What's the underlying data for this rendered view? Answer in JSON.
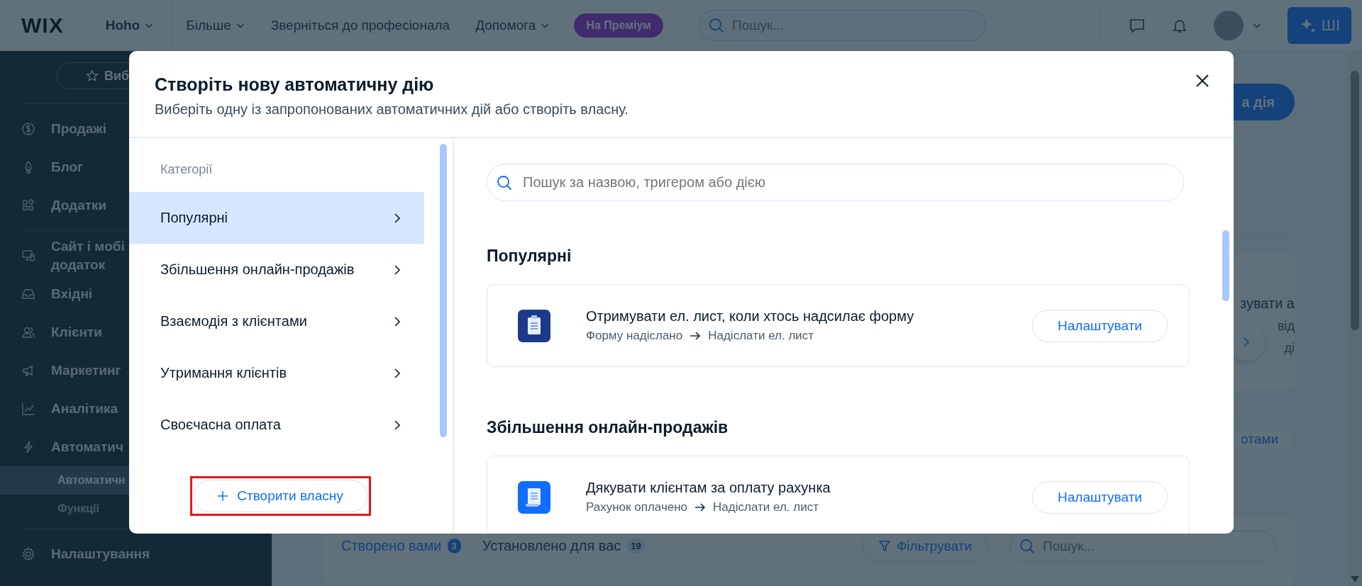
{
  "top_bar": {
    "logo": "WIX",
    "site_name": "Hoho",
    "menu": [
      {
        "label": "Більше",
        "caret": true
      },
      {
        "label": "Зверніться до професіонала",
        "caret": false
      },
      {
        "label": "Допомога",
        "caret": true
      }
    ],
    "upgrade_badge": "На Преміум",
    "search": {
      "placeholder": "Пошук..."
    },
    "ai_button": "ШІ"
  },
  "sidebar": {
    "favorites_button": "Виб",
    "groups": [
      {
        "items": [
          {
            "label": "Продажі"
          },
          {
            "label": "Блог"
          },
          {
            "label": "Додатки"
          }
        ]
      },
      {
        "items": [
          {
            "label": "Сайт і мобі\nдодаток"
          },
          {
            "label": "Вхідні"
          },
          {
            "label": "Клієнти"
          },
          {
            "label": "Маркетинг"
          },
          {
            "label": "Аналітика"
          },
          {
            "label": "Автоматич",
            "children": [
              {
                "label": "Автоматичн",
                "selected": true
              },
              {
                "label": "Функції",
                "selected": false
              }
            ]
          }
        ]
      },
      {
        "items": [
          {
            "label": "Налаштування"
          }
        ]
      }
    ]
  },
  "main": {
    "new_action_button": "а дія",
    "carousel_card": {
      "title": "зувати а",
      "lines": [
        "від",
        "ді"
      ]
    },
    "bots_button": "отами",
    "tabs": [
      {
        "label": "Створено вами",
        "count": "3",
        "selected": true
      },
      {
        "label": "Установлено для вас",
        "count": "19",
        "selected": false
      }
    ],
    "filter_button": "Фільтрувати",
    "search": {
      "placeholder": "Пошук..."
    }
  },
  "modal": {
    "title": "Створіть нову автоматичну дію",
    "subtitle": "Виберіть одну із запропонованих автоматичних дій або створіть власну.",
    "categories_label": "Категорії",
    "categories": [
      {
        "label": "Популярні",
        "selected": true
      },
      {
        "label": "Збільшення онлайн-продажів",
        "selected": false
      },
      {
        "label": "Взаємодія з клієнтами",
        "selected": false
      },
      {
        "label": "Утримання клієнтів",
        "selected": false
      },
      {
        "label": "Своєчасна оплата",
        "selected": false
      }
    ],
    "create_button": "Створити власну",
    "search": {
      "placeholder": "Пошук за назвою, тригером або дією"
    },
    "sections": [
      {
        "heading": "Популярні",
        "templates": [
          {
            "kind": "form",
            "title": "Отримувати ел. лист, коли хтось надсилає форму",
            "trigger": "Форму надіслано",
            "action": "Надіслати ел. лист",
            "button": "Налаштувати"
          }
        ]
      },
      {
        "heading": "Збільшення онлайн-продажів",
        "templates": [
          {
            "kind": "invoice",
            "title": "Дякувати клієнтам за оплату рахунка",
            "trigger": "Рахунок оплачено",
            "action": "Надіслати ел. лист",
            "button": "Налаштувати"
          }
        ]
      }
    ]
  }
}
